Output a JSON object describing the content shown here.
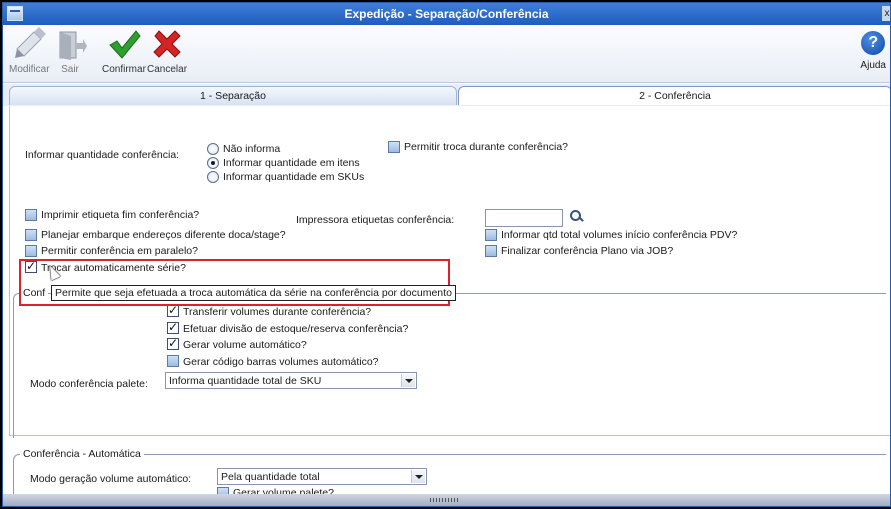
{
  "window": {
    "title": "Expedição - Separação/Conferência"
  },
  "toolbar": {
    "modificar": "Modificar",
    "sair": "Sair",
    "confirmar": "Confirmar",
    "cancelar": "Cancelar",
    "ajuda": "Ajuda"
  },
  "tabs": [
    {
      "label": "1 - Separação",
      "active": false
    },
    {
      "label": "2 - Conferência",
      "active": true
    }
  ],
  "form": {
    "informar_qtd_label": "Informar quantidade conferência:",
    "radio_options": [
      {
        "label": "Não informa",
        "selected": false
      },
      {
        "label": "Informar quantidade em itens",
        "selected": true
      },
      {
        "label": "Informar quantidade em SKUs",
        "selected": false
      }
    ],
    "permitir_troca": "Permitir troca durante conferência?",
    "imprimir_etiqueta": "Imprimir etiqueta fim conferência?",
    "impressora_label": "Impressora etiquetas conferência:",
    "impressora_value": "",
    "planejar_embarque": "Planejar embarque endereços diferente doca/stage?",
    "informar_qtd_volumes": "Informar qtd total volumes início conferência PDV?",
    "permitir_paralelo": "Permitir conferência em paralelo?",
    "finalizar_plano": "Finalizar conferência Plano via JOB?",
    "trocar_serie": "Trocar automaticamente série?",
    "group_conf_title": "Conf",
    "transferir_volumes": "Transferir volumes durante conferência?",
    "efetuar_divisao": "Efetuar divisão de estoque/reserva conferência?",
    "gerar_volume": "Gerar volume automático?",
    "gerar_codigo": "Gerar código barras volumes automático?",
    "modo_palete_label": "Modo conferência palete:",
    "modo_palete_value": "Informa quantidade total de SKU",
    "group_auto_title": "Conferência - Automática",
    "modo_geracao_label": "Modo geração volume automático:",
    "modo_geracao_value": "Pela quantidade total",
    "gerar_volume_palete": "Gerar volume palete?"
  },
  "tooltip": "Permite que seja efetuada a troca automática da série na conferência por documento",
  "colors": {
    "title_bar": "#1f5cc0",
    "highlight": "#e0202a",
    "confirm": "#2e9e2e",
    "cancel": "#d42424"
  }
}
